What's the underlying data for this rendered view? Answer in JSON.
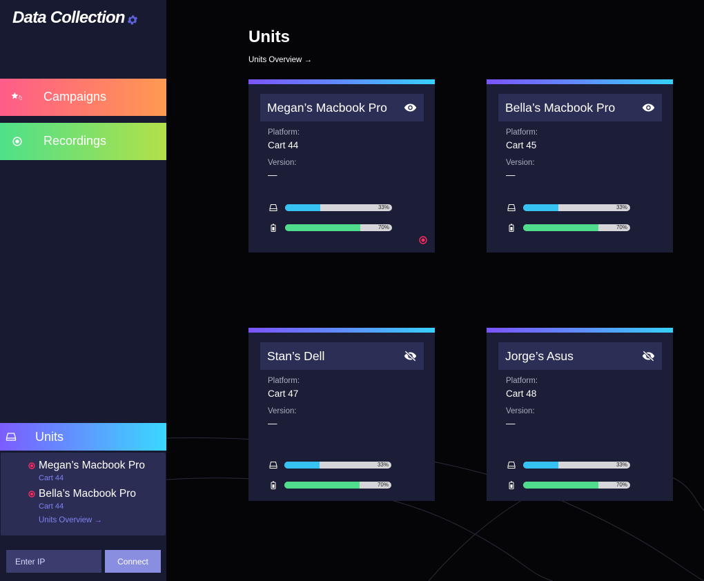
{
  "sidebar": {
    "brand": "Data Collection",
    "nav": [
      {
        "label": "Campaigns",
        "icon": "stars-icon"
      },
      {
        "label": "Recordings",
        "icon": "record-icon"
      }
    ],
    "units_header": "Units",
    "units": [
      {
        "name": "Megan’s Macbook Pro",
        "cart": "Cart 44"
      },
      {
        "name": "Bella’s Macbook Pro",
        "cart": "Cart 44"
      }
    ],
    "overview_link": "Units Overview →",
    "ip_placeholder": "Enter IP",
    "connect_label": "Connect"
  },
  "main": {
    "title": "Units",
    "overview_link": "Units Overview  →",
    "platform_label": "Platform:",
    "version_label": "Version:",
    "cards": [
      {
        "name": "Megan’s Macbook Pro",
        "visible": true,
        "platform": "Cart 44",
        "version": "—",
        "storage": 33,
        "storage_text": "33%",
        "battery": 70,
        "battery_text": "70%",
        "recording": true
      },
      {
        "name": "Bella’s Macbook Pro",
        "visible": true,
        "platform": "Cart 45",
        "version": "—",
        "storage": 33,
        "storage_text": "33%",
        "battery": 70,
        "battery_text": "70%",
        "recording": false
      },
      {
        "name": "Stan’s Dell",
        "visible": false,
        "platform": "Cart 47",
        "version": "—",
        "storage": 33,
        "storage_text": "33%",
        "battery": 70,
        "battery_text": "70%",
        "recording": false
      },
      {
        "name": "Jorge’s Asus",
        "visible": false,
        "platform": "Cart 48",
        "version": "—",
        "storage": 33,
        "storage_text": "33%",
        "battery": 70,
        "battery_text": "70%",
        "recording": false
      }
    ]
  },
  "colors": {
    "sidebar_bg": "#171a30",
    "card_bg": "#1b1e36",
    "accent_purple": "#7b54ff",
    "accent_cyan": "#36d2ff",
    "record_red": "#ff2a5f"
  }
}
